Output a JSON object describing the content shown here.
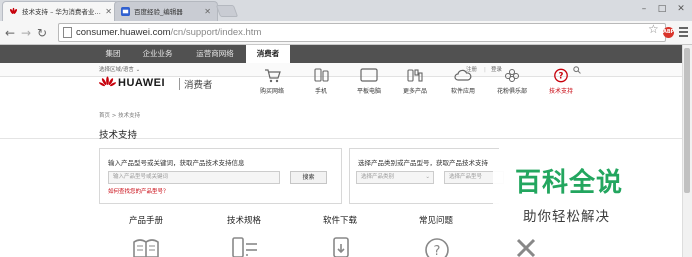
{
  "browser": {
    "tabs": [
      {
        "label": "技术支持 – 华为消费者业…",
        "active": true
      },
      {
        "label": "百度经验_编辑器",
        "active": false
      }
    ],
    "url_host": "consumer.huawei.com",
    "url_path": "/cn/support/index.htm",
    "window_controls": [
      "–",
      "□",
      "✕"
    ]
  },
  "site": {
    "top_nav": [
      "集团",
      "企业业务",
      "运营商网络",
      "消费者"
    ],
    "top_nav_active": "消费者",
    "region_select": "选择区域/语言",
    "login": "注册",
    "register": "登录",
    "brand": "HUAWEI",
    "brand_sub": "消费者",
    "categories": [
      {
        "label": "购买网络",
        "icon": "cart-icon"
      },
      {
        "label": "手机",
        "icon": "phone-icon"
      },
      {
        "label": "平板电脑",
        "icon": "tablet-icon"
      },
      {
        "label": "更多产品",
        "icon": "more-products-icon"
      },
      {
        "label": "软件应用",
        "icon": "cloud-icon"
      },
      {
        "label": "花粉俱乐部",
        "icon": "flower-icon"
      },
      {
        "label": "技术支持",
        "icon": "support-icon"
      }
    ],
    "active_category": "技术支持",
    "brand_red": "#c7000b"
  },
  "support": {
    "breadcrumb": "首页 > 技术支持",
    "title": "技术支持",
    "panel_left": {
      "title": "输入产品型号或关键词，获取产品技术支持信息",
      "placeholder": "输入产品型号或关键词",
      "button": "搜索",
      "help_link": "如何查找您的产品型号？"
    },
    "panel_right": {
      "title": "选择产品类别或产品型号，获取产品技术支持",
      "select_category": "选择产品类别",
      "select_model": "选择产品型号"
    },
    "sections": [
      "产品手册",
      "技术规格",
      "软件下载",
      "常见问题"
    ]
  },
  "watermark": {
    "title": "百科全说",
    "subtitle": "助你轻松解决",
    "color": "#23a65f"
  }
}
